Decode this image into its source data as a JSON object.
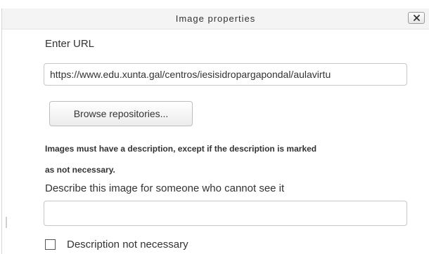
{
  "dialog": {
    "title": "Image properties",
    "close_icon": "close-icon"
  },
  "form": {
    "url_label": "Enter URL",
    "url_value": "https://www.edu.xunta.gal/centros/iesisidropargapondal/aulavirtu",
    "browse_label": "Browse repositories...",
    "warning_line1": "Images must have a description, except if the description is marked",
    "warning_line2": "as not necessary.",
    "description_label": "Describe this image for someone who cannot see it",
    "description_value": "",
    "checkbox_label": "Description not necessary",
    "checkbox_checked": false
  }
}
